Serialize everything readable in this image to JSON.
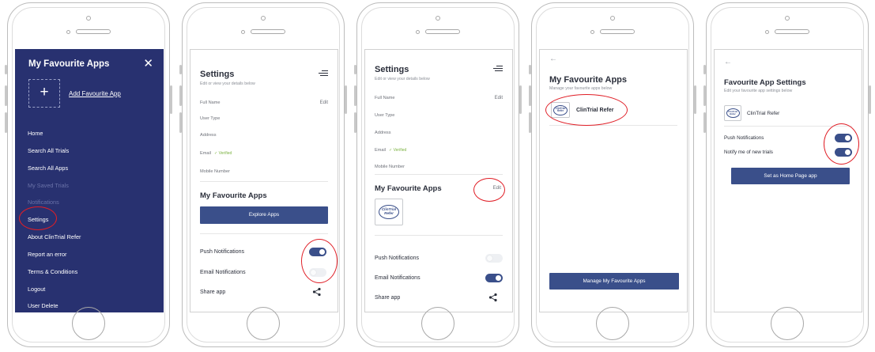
{
  "menu": {
    "title": "My Favourite Apps",
    "add_app": "Add Favourite App",
    "items": [
      {
        "label": "Home"
      },
      {
        "label": "Search All Trials"
      },
      {
        "label": "Search All Apps"
      },
      {
        "label": "My Saved Trials"
      },
      {
        "label": "Notifications"
      },
      {
        "label": "Settings"
      },
      {
        "label": "About ClinTrial Refer"
      },
      {
        "label": "Report an error"
      },
      {
        "label": "Terms & Conditions"
      },
      {
        "label": "Logout"
      },
      {
        "label": "User Delete"
      }
    ]
  },
  "settings": {
    "title": "Settings",
    "subtitle": "Edit or view your details below",
    "edit": "Edit",
    "fields": {
      "full_name": "Full Name",
      "user_type": "User Type",
      "address": "Address",
      "email": "Email",
      "verified": "✓ Verified",
      "mobile": "Mobile Number"
    },
    "fav_apps_title": "My Favourite Apps",
    "explore_button": "Explore Apps",
    "push_notifications": "Push Notifications",
    "email_notifications": "Email Notifications",
    "share_app": "Share app"
  },
  "fav_apps": {
    "title": "My Favourite Apps",
    "subtitle": "Manage your favourite apps below",
    "app_name": "ClinTrial Refer",
    "manage_button": "Manage My Favourite Apps"
  },
  "fav_settings": {
    "title": "Favourite App Settings",
    "subtitle": "Edit your favourite app settings below",
    "app_name": "ClinTrial Refer",
    "push_notifications": "Push Notifications",
    "notify_trials": "Notify me of new trials",
    "home_button": "Set as Home Page app"
  },
  "logo": {
    "line1": "ClinTrial",
    "line2": "Refer"
  },
  "toggles": {
    "screen2_push": "on",
    "screen2_email": "off",
    "screen3_push": "off",
    "screen3_email": "on",
    "screen5_push": "on",
    "screen5_notify": "on"
  },
  "icons": {
    "close": "close-icon",
    "add": "plus-icon",
    "menu": "menu-icon",
    "share": "share-icon",
    "back": "back-arrow-icon"
  },
  "colors": {
    "menu_bg": "#283170",
    "accent": "#3a4f8a",
    "highlight": "#e01e26",
    "verified": "#7cb342"
  }
}
